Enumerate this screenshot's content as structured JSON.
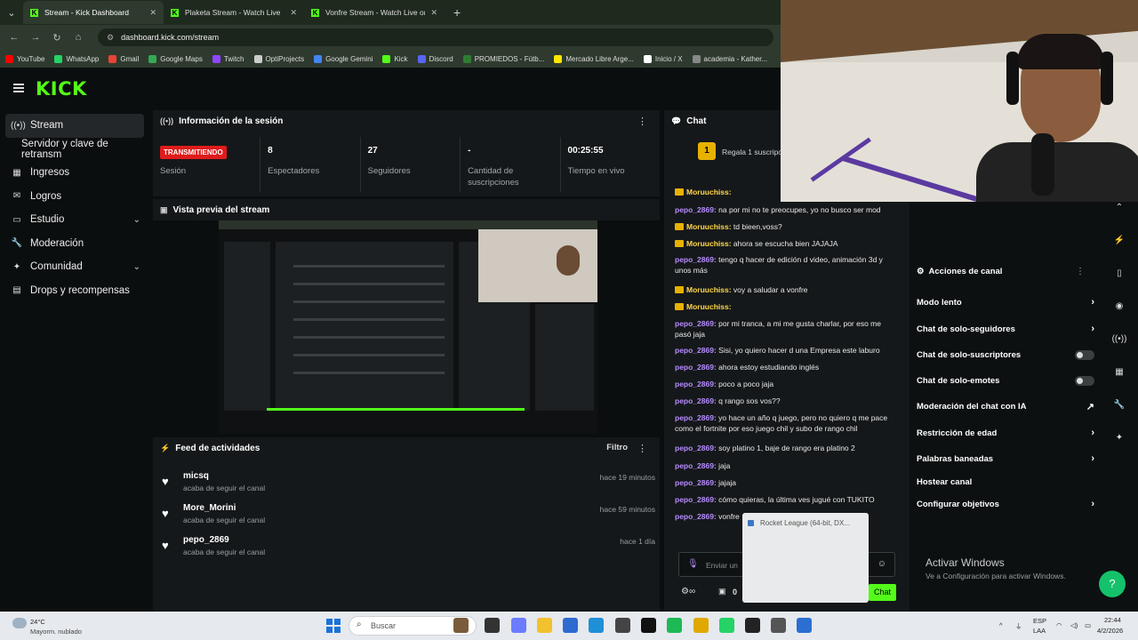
{
  "browser": {
    "tabs": [
      {
        "title": "Stream - Kick Dashboard",
        "active": true
      },
      {
        "title": "Plaketa Stream - Watch Live",
        "active": false
      },
      {
        "title": "Vonfre Stream - Watch Live on",
        "active": false
      }
    ],
    "url": "dashboard.kick.com/stream",
    "bookmarks": [
      {
        "label": "YouTube",
        "color": "#ff0000"
      },
      {
        "label": "WhatsApp",
        "color": "#25d366"
      },
      {
        "label": "Gmail",
        "color": "#ea4335"
      },
      {
        "label": "Google Maps",
        "color": "#34a853"
      },
      {
        "label": "Twitch",
        "color": "#9146ff"
      },
      {
        "label": "OptiProjects",
        "color": "#cccccc"
      },
      {
        "label": "Google Gemini",
        "color": "#4285f4"
      },
      {
        "label": "Kick",
        "color": "#53fc18"
      },
      {
        "label": "Discord",
        "color": "#5865f2"
      },
      {
        "label": "PROMIEDOS - Fútb...",
        "color": "#2e7d32"
      },
      {
        "label": "Mercado Libre Arge...",
        "color": "#ffe600"
      },
      {
        "label": "Inicio / X",
        "color": "#ffffff"
      },
      {
        "label": "academia - Kather...",
        "color": "#888888"
      }
    ]
  },
  "app": {
    "logo": "KICK",
    "accent": "#53fc18"
  },
  "sidebar": {
    "items": [
      {
        "label": "Stream",
        "icon": "stream-icon",
        "glyph": "((•))",
        "active": true
      },
      {
        "label": "Servidor y clave de retransm",
        "icon": "",
        "glyph": "",
        "sub": true
      },
      {
        "label": "Ingresos",
        "icon": "revenue-icon",
        "glyph": "▦"
      },
      {
        "label": "Logros",
        "icon": "achievements-icon",
        "glyph": "✉"
      },
      {
        "label": "Estudio",
        "icon": "studio-icon",
        "glyph": "▭",
        "chevron": true
      },
      {
        "label": "Moderación",
        "icon": "moderation-icon",
        "glyph": "🔧"
      },
      {
        "label": "Comunidad",
        "icon": "community-icon",
        "glyph": "✦",
        "chevron": true
      },
      {
        "label": "Drops y recompensas",
        "icon": "drops-icon",
        "glyph": "▤"
      }
    ]
  },
  "session": {
    "title": "Información de la sesión",
    "status_badge": "TRANSMITIENDO",
    "stats": [
      {
        "value": "",
        "label": "Sesión"
      },
      {
        "value": "8",
        "label": "Espectadores"
      },
      {
        "value": "27",
        "label": "Seguidores"
      },
      {
        "value": "-",
        "label": "Cantidad de suscripciones"
      },
      {
        "value": "00:25:55",
        "label": "Tiempo en vivo"
      }
    ]
  },
  "preview": {
    "title": "Vista previa del stream"
  },
  "feed": {
    "title": "Feed de actividades",
    "filter_label": "Filtro",
    "items": [
      {
        "name": "micsq",
        "action": "acaba de seguir el canal",
        "time": "hace 19 minutos"
      },
      {
        "name": "More_Morini",
        "action": "acaba de seguir el canal",
        "time": "hace 59 minutos"
      },
      {
        "name": "pepo_2869",
        "action": "acaba de seguir el canal",
        "time": "hace 1 día"
      }
    ]
  },
  "chat": {
    "title": "Chat",
    "gift_banner": "Regala 1 suscripci",
    "messages": [
      {
        "user": "Moruuchiss:",
        "text": "",
        "mod": true
      },
      {
        "user": "pepo_2869:",
        "text": "na por mi no te preocupes, yo no busco ser mod",
        "mod": false
      },
      {
        "user": "Moruuchiss:",
        "text": "td bieen,voss?",
        "mod": true
      },
      {
        "user": "Moruuchiss:",
        "text": "ahora se escucha bien JAJAJA",
        "mod": true
      },
      {
        "user": "pepo_2869:",
        "text": "tengo q hacer de edición d video, animación 3d y unos más",
        "mod": false
      },
      {
        "user": "Moruuchiss:",
        "text": "voy a saludar a vonfre",
        "mod": true
      },
      {
        "user": "Moruuchiss:",
        "text": "",
        "mod": true
      },
      {
        "user": "pepo_2869:",
        "text": "por mi tranca, a mi me gusta charlar, por eso me pasó jaja",
        "mod": false
      },
      {
        "user": "pepo_2869:",
        "text": "Sisi, yo quiero hacer d una Empresa este laburo",
        "mod": false
      },
      {
        "user": "pepo_2869:",
        "text": "ahora estoy estudiando inglés",
        "mod": false
      },
      {
        "user": "pepo_2869:",
        "text": "poco a poco jaja",
        "mod": false
      },
      {
        "user": "pepo_2869:",
        "text": "q rango sos vos??",
        "mod": false
      },
      {
        "user": "pepo_2869:",
        "text": "yo hace un año q juego, pero no quiero q me pace como el fortnite por eso juego chil y subo de rango chil",
        "mod": false
      },
      {
        "user": "pepo_2869:",
        "text": "soy platino 1, baje de rango era platino 2",
        "mod": false
      },
      {
        "user": "pepo_2869:",
        "text": "jaja",
        "mod": false
      },
      {
        "user": "pepo_2869:",
        "text": "jajaja",
        "mod": false
      },
      {
        "user": "pepo_2869:",
        "text": "cómo quieras, la última ves jugué con TUKITO",
        "mod": false
      },
      {
        "user": "pepo_2869:",
        "text": "vonfre",
        "mod": false
      }
    ],
    "input_placeholder": "Enviar un",
    "send_label": "Chat",
    "count": "0",
    "popup_title": "Rocket League (64-bit, DX..."
  },
  "actions": {
    "title": "Acciones de canal",
    "items": [
      {
        "label": "Modo lento",
        "kind": "chevron"
      },
      {
        "label": "Chat de solo-seguidores",
        "kind": "chevron"
      },
      {
        "label": "Chat de solo-suscriptores",
        "kind": "toggle"
      },
      {
        "label": "Chat de solo-emotes",
        "kind": "toggle"
      },
      {
        "label": "Moderación del chat con IA",
        "kind": "external"
      },
      {
        "label": "Restricción de edad",
        "kind": "chevron"
      },
      {
        "label": "Palabras baneadas",
        "kind": "chevron"
      },
      {
        "label": "Hostear canal",
        "kind": "none"
      },
      {
        "label": "Configurar objetivos",
        "kind": "chevron"
      }
    ]
  },
  "windows_activation": {
    "title": "Activar Windows",
    "subtitle": "Ve a Configuración para activar Windows."
  },
  "taskbar": {
    "weather_temp": "24°C",
    "weather_text": "Mayorm. nublado",
    "search_placeholder": "Buscar",
    "lang": "ESP",
    "lang2": "LAA",
    "time": "22:44",
    "date": "4/2/2026"
  }
}
